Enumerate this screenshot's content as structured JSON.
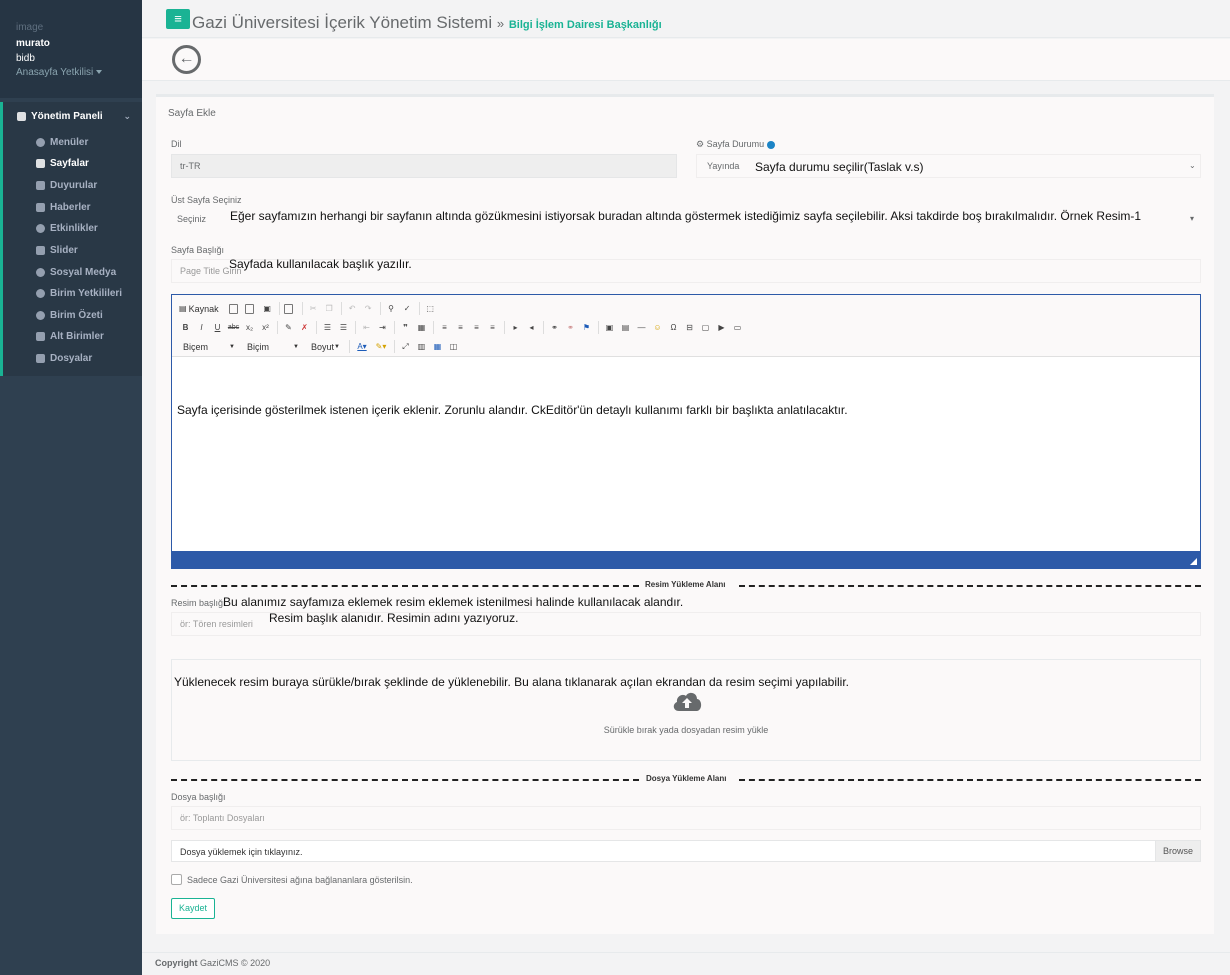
{
  "sidebar": {
    "profile": {
      "image_alt": "image",
      "username": "murato",
      "department": "bidb",
      "role": "Anasayfa Yetkilisi"
    },
    "section_title": "Yönetim Paneli",
    "items": [
      {
        "label": "Menüler",
        "icon": "gear-icon"
      },
      {
        "label": "Sayfalar",
        "icon": "page-icon"
      },
      {
        "label": "Duyurular",
        "icon": "megaphone-icon"
      },
      {
        "label": "Haberler",
        "icon": "newspaper-icon"
      },
      {
        "label": "Etkinlikler",
        "icon": "clock-icon"
      },
      {
        "label": "Slider",
        "icon": "sliders-icon"
      },
      {
        "label": "Sosyal Medya",
        "icon": "globe-icon"
      },
      {
        "label": "Birim Yetkilileri",
        "icon": "user-icon"
      },
      {
        "label": "Birim Özeti",
        "icon": "info-icon"
      },
      {
        "label": "Alt Birimler",
        "icon": "sitemap-icon"
      },
      {
        "label": "Dosyalar",
        "icon": "briefcase-icon"
      }
    ],
    "active_item": "Sayfalar"
  },
  "header": {
    "menu_glyph": "≡",
    "system_title": "Gazi Üniversitesi İçerik Yönetim Sistemi",
    "separator": "»",
    "department_title": "Bilgi İşlem Dairesi Başkanlığı",
    "back_glyph": "←"
  },
  "form": {
    "title": "Sayfa Ekle",
    "language": {
      "label": "Dil",
      "value": "tr-TR"
    },
    "status": {
      "label": "Sayfa Durumu",
      "value": "Yayında",
      "note": "Sayfa durumu seçilir(Taslak v.s)"
    },
    "parent": {
      "label": "Üst Sayfa Seçiniz",
      "value": "Seçiniz",
      "note": "Eğer sayfamızın herhangi bir sayfanın altında gözükmesini istiyorsak buradan altında göstermek istediğimiz sayfa seçilebilir. Aksi takdirde boş bırakılmalıdır. Örnek Resim-1"
    },
    "page_title": {
      "label": "Sayfa Başlığı",
      "placeholder": "Page Title Girin",
      "note": "Sayfada kullanılacak başlık yazılır."
    },
    "editor": {
      "source_label": "Kaynak",
      "format_label": "Biçem",
      "style_label": "Biçim",
      "size_label": "Boyut",
      "content_note": "Sayfa içerisinde gösterilmek istenen içerik eklenir. Zorunlu alandır. CkEditör'ün detaylı kullanımı farklı bir başlıkta anlatılacaktır."
    },
    "image_section": {
      "title": "Resim Yükleme Alanı",
      "label": "Resim başlığı",
      "placeholder": "ör: Tören resimleri",
      "note_section": "Bu alanımız sayfamıza eklemek resim eklemek istenilmesi halinde kullanılacak alandır.",
      "note_title": "Resim başlık alanıdır. Resimin adını yazıyoruz.",
      "dropzone_note": "Yüklenecek resim buraya sürükle/bırak şeklinde de yüklenebilir. Bu alana tıklanarak açılan ekrandan da resim seçimi yapılabilir.",
      "dropzone_text": "Sürükle bırak yada dosyadan resim yükle"
    },
    "file_section": {
      "title": "Dosya Yükleme Alanı",
      "label": "Dosya başlığı",
      "placeholder": "ör: Toplantı Dosyaları",
      "file_text": "Dosya yüklemek için tıklayınız.",
      "browse_label": "Browse"
    },
    "restrict_label": "Sadece Gazi Üniversitesi ağına bağlananlara gösterilsin.",
    "save_label": "Kaydet"
  },
  "footer": {
    "copyright_label": "Copyright",
    "text": "GaziCMS © 2020"
  },
  "colors": {
    "sidebar": "#2f4050",
    "accent": "#1ab394",
    "editor": "#2d5aa8"
  }
}
